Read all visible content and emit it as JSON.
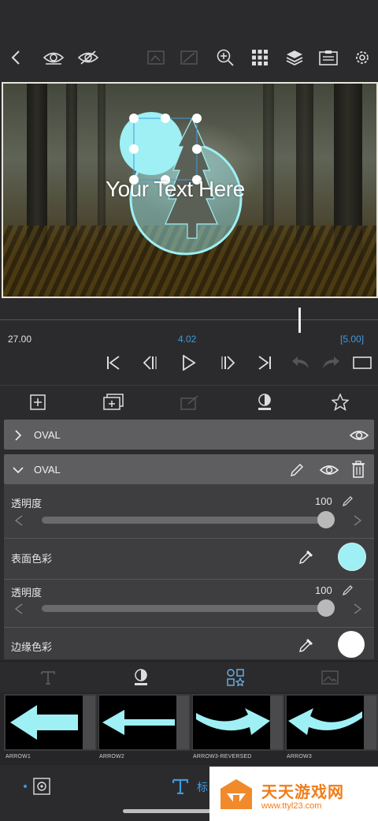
{
  "canvas": {
    "overlay_text": "Your Text Here",
    "shape_color": "#9ef0f5"
  },
  "timeline": {
    "left_time": "27.00",
    "current_time": "4.02",
    "right_time": "[5.00]",
    "accent": "#3d9bdc"
  },
  "layers": {
    "collapsed": {
      "label": "OVAL"
    },
    "expanded": {
      "label": "OVAL",
      "opacity1_label": "透明度",
      "opacity1_value": "100",
      "surface_color_label": "表面色彩",
      "opacity2_label": "透明度",
      "opacity2_value": "100",
      "border_color_label": "边缘色彩",
      "surface_color": "#9ef0f5",
      "border_color": "#ffffff"
    }
  },
  "library": {
    "items": [
      "ARROW1",
      "ARROW2",
      "ARROW3-REVERSED",
      "ARROW3"
    ]
  },
  "bottom": {
    "title_partial": "标",
    "watermark_title": "天天游戏网",
    "watermark_url": "www.ttyl23.com"
  }
}
